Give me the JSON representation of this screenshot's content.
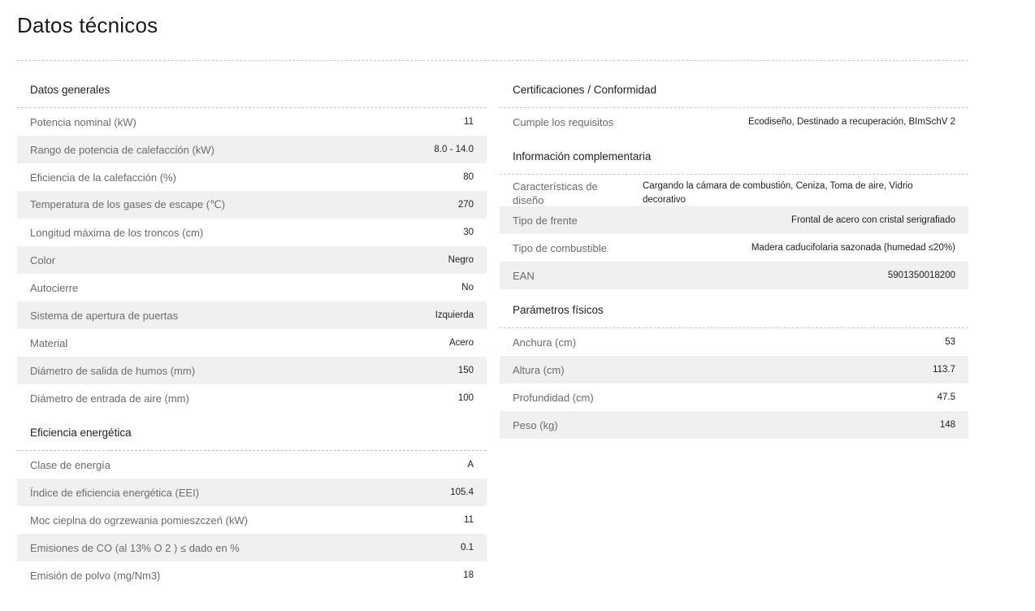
{
  "page": {
    "title": "Datos técnicos"
  },
  "left": {
    "general": {
      "title": "Datos generales",
      "rows": [
        {
          "label": "Potencia nominal (kW)",
          "value": "11"
        },
        {
          "label": "Rango de potencia de calefacción (kW)",
          "value": "8.0 - 14.0"
        },
        {
          "label": "Eficiencia de la calefacción (%)",
          "value": "80"
        },
        {
          "label": "Temperatura de los gases de escape (℃)",
          "value": "270"
        },
        {
          "label": "Longitud máxima de los troncos (cm)",
          "value": "30"
        },
        {
          "label": "Color",
          "value": "Negro"
        },
        {
          "label": "Autocierre",
          "value": "No"
        },
        {
          "label": "Sistema de apertura de puertas",
          "value": "Izquierda"
        },
        {
          "label": "Material",
          "value": "Acero"
        },
        {
          "label": "Diámetro de salida de humos (mm)",
          "value": "150"
        },
        {
          "label": "Diámetro de entrada de aire (mm)",
          "value": "100"
        }
      ]
    },
    "energy": {
      "title": "Eficiencia energética",
      "rows": [
        {
          "label": "Clase de energía",
          "value": "A"
        },
        {
          "label": "Índice de eficiencia energética (EEI)",
          "value": "105.4"
        },
        {
          "label": "Moc cieplna do ogrzewania pomieszczeń (kW)",
          "value": "11"
        },
        {
          "label": "Emisiones de CO (al 13% O 2 ) ≤ dado en %",
          "value": "0.1"
        },
        {
          "label": "Emisión de polvo (mg/Nm3)",
          "value": "18"
        }
      ]
    }
  },
  "right": {
    "certs": {
      "title": "Certificaciones / Conformidad",
      "rows": [
        {
          "label": "Cumple los requisitos",
          "value": "Ecodiseño, Destinado a recuperación, BImSchV 2"
        }
      ]
    },
    "complementary": {
      "title": "Información complementaria",
      "rows": [
        {
          "label": "Características de diseño",
          "value": "Cargando la cámara de combustión, Ceniza, Toma de aire, Vidrio decorativo"
        },
        {
          "label": "Tipo de frente",
          "value": "Frontal de acero con cristal serigrafiado"
        },
        {
          "label": "Tipo de combustible",
          "value": "Madera caducifolaria sazonada (humedad ≤20%)"
        },
        {
          "label": "EAN",
          "value": "5901350018200"
        }
      ]
    },
    "physical": {
      "title": "Parámetros físicos",
      "rows": [
        {
          "label": "Anchura (cm)",
          "value": "53"
        },
        {
          "label": "Altura (cm)",
          "value": "113.7"
        },
        {
          "label": "Profundidad (cm)",
          "value": "47.5"
        },
        {
          "label": "Peso (kg)",
          "value": "148"
        }
      ]
    }
  }
}
